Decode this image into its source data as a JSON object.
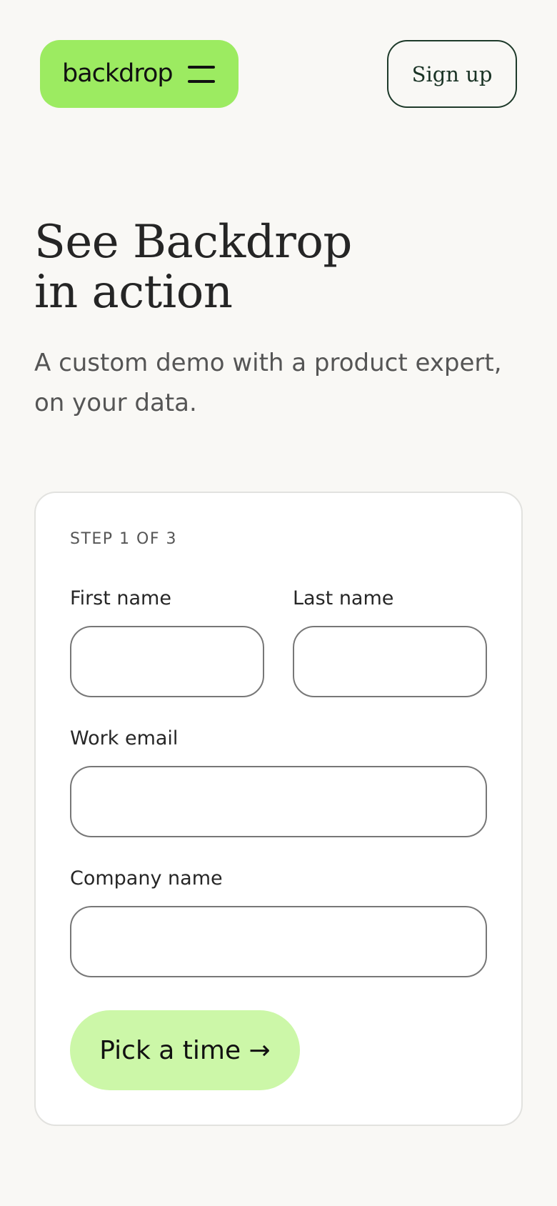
{
  "header": {
    "logo_text": "backdrop",
    "menu_icon": "hamburger-menu-icon",
    "signup_label": "Sign up",
    "accent_color": "#9ceb61"
  },
  "hero": {
    "title_line1": "See Backdrop",
    "title_line2": "in action",
    "subtitle": "A custom demo with a product expert, on your data."
  },
  "form": {
    "step_text": "STEP 1 OF 3",
    "first_name_label": "First name",
    "first_name_value": "",
    "last_name_label": "Last name",
    "last_name_value": "",
    "email_label": "Work email",
    "email_value": "",
    "company_label": "Company name",
    "company_value": "",
    "submit_label": "Pick a time →",
    "submit_color": "#ccf7a8"
  }
}
